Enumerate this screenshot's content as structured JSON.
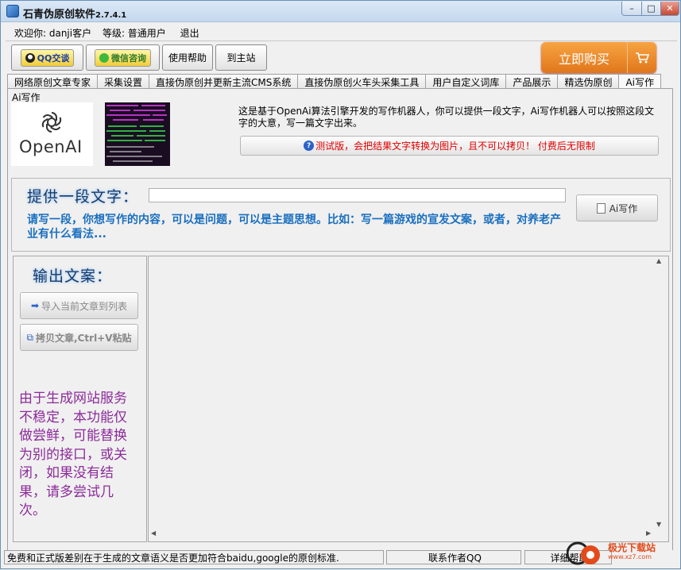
{
  "window": {
    "title": "石青伪原创软件",
    "version": "2.7.4.1",
    "controls": {
      "minimize": "–",
      "maximize": "□",
      "close": "✕"
    }
  },
  "user": {
    "welcome": "欢迎你: danji客户",
    "level": "等级: 普通用户",
    "logout": "退出"
  },
  "toolbar": {
    "qq_label": "QQ交谈",
    "wechat_label": "微信咨询",
    "help_label": "使用帮助",
    "home_label": "到主站",
    "buy_label": "立即购买",
    "cart_icon": "cart-icon"
  },
  "tabs": [
    {
      "label": "网络原创文章专家"
    },
    {
      "label": "采集设置"
    },
    {
      "label": "直接伪原创并更新主流CMS系统"
    },
    {
      "label": "直接伪原创火车头采集工具"
    },
    {
      "label": "用户自定义词库"
    },
    {
      "label": "产品展示"
    },
    {
      "label": "精选伪原创"
    },
    {
      "label": "Ai写作"
    }
  ],
  "panel": {
    "group_label": "Ai写作",
    "openai_text": "OpenAI",
    "description": "这是基于OpenAi算法引擎开发的写作机器人，你可以提供一段文字，Ai写作机器人可以按照这段文字的大意，写一篇文字出来。",
    "notice": "测试版，会把结果文字转换为图片，且不可以拷贝！ 付费后无限制"
  },
  "input_section": {
    "prompt_label": "提供一段文字：",
    "input_value": "",
    "hint": "请写一段，你想写作的内容，可以是问题，可以是主题思想。比如：写一篇游戏的宣发文案，或者，对养老产业有什么看法...",
    "ai_button": "Ai写作"
  },
  "output_section": {
    "label": "输出文案：",
    "import_button": "导入当前文章到列表",
    "copy_button": "拷贝文章,Ctrl+V粘贴",
    "note": "由于生成网站服务不稳定，本功能仅做尝鲜，可能替换为别的接口，或关闭，如果没有结果，请多尝试几次。",
    "output_value": ""
  },
  "statusbar": {
    "message": "免费和正式版差别在于生成的文章语义是否更加符合baidu,google的原创标准.",
    "contact": "联系作者QQ",
    "help": "详细帮助"
  },
  "watermark": {
    "text": "极光下载站",
    "url": "www.xz7.com"
  },
  "colors": {
    "accent_orange": "#e0761c",
    "hint_blue": "#1a6fbf",
    "notice_red": "#e00000",
    "note_purple": "#8c2b9a"
  }
}
